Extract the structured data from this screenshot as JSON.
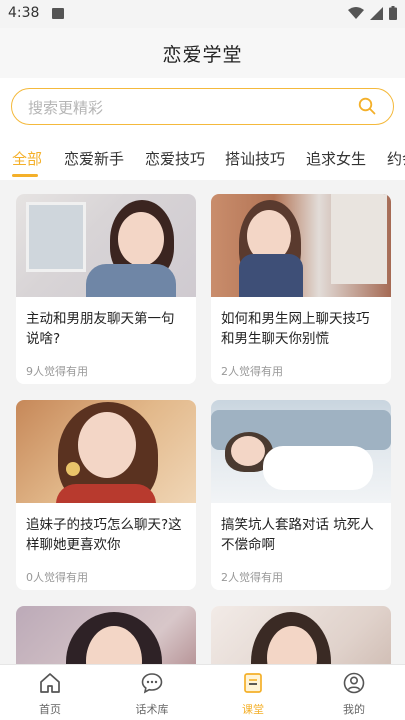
{
  "status_bar": {
    "time": "4:38"
  },
  "header": {
    "title": "恋爱学堂"
  },
  "search": {
    "placeholder": "搜索更精彩"
  },
  "tabs": [
    {
      "label": "全部",
      "active": true
    },
    {
      "label": "恋爱新手",
      "active": false
    },
    {
      "label": "恋爱技巧",
      "active": false
    },
    {
      "label": "搭讪技巧",
      "active": false
    },
    {
      "label": "追求女生",
      "active": false
    },
    {
      "label": "约会",
      "active": false
    }
  ],
  "articles": [
    {
      "title": "主动和男朋友聊天第一句说啥?",
      "useful": "9人觉得有用"
    },
    {
      "title": "如何和男生网上聊天技巧和男生聊天你别慌",
      "useful": "2人觉得有用"
    },
    {
      "title": "追妹子的技巧怎么聊天?这样聊她更喜欢你",
      "useful": "0人觉得有用"
    },
    {
      "title": "搞笑坑人套路对话 坑死人不偿命啊",
      "useful": "2人觉得有用"
    }
  ],
  "bottom_nav": [
    {
      "label": "首页",
      "icon": "home-icon",
      "active": false
    },
    {
      "label": "话术库",
      "icon": "chat-bubble-icon",
      "active": false
    },
    {
      "label": "课堂",
      "icon": "classroom-icon",
      "active": true
    },
    {
      "label": "我的",
      "icon": "profile-icon",
      "active": false
    }
  ],
  "colors": {
    "accent": "#f4b02a",
    "search_border": "#f4b93c"
  }
}
